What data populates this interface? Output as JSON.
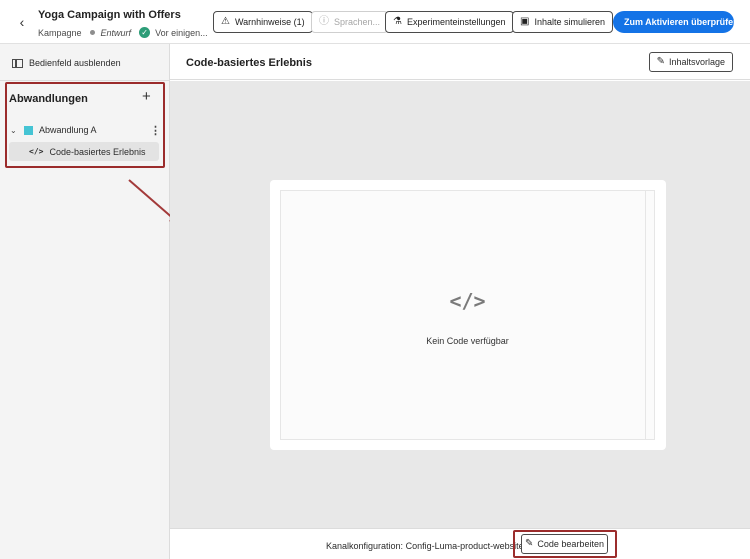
{
  "header": {
    "back_icon": "chevron-left-icon",
    "title": "Yoga Campaign with Offers",
    "type": "Kampagne",
    "status": "Entwurf",
    "sync_status": "Vor einigen...",
    "buttons": {
      "warnings": "Warnhinweise (1)",
      "languages": "Sprachen...",
      "experiment": "Experimenteinstellungen",
      "simulate": "Inhalte simulieren",
      "review": "Zum Aktivieren überprüfen"
    }
  },
  "sidebar": {
    "hide_panel": "Bedienfeld ausblenden",
    "variants_title": "Abwandlungen",
    "variant": {
      "label": "Abwandlung A",
      "color": "#45c4d4"
    },
    "experience_label": "Code-basiertes Erlebnis"
  },
  "main": {
    "title": "Code-basiertes Erlebnis",
    "template_button": "Inhaltsvorlage",
    "code_glyph": "</>",
    "empty_message": "Kein Code verfügbar"
  },
  "footer": {
    "channel_label": "Kanalkonfiguration:",
    "channel_value": "Config-Luma-product-website",
    "edit_button": "Code bearbeiten"
  },
  "colors": {
    "accent": "#1473e6",
    "highlight_box": "#9b2c2c",
    "success": "#2d9d78"
  }
}
